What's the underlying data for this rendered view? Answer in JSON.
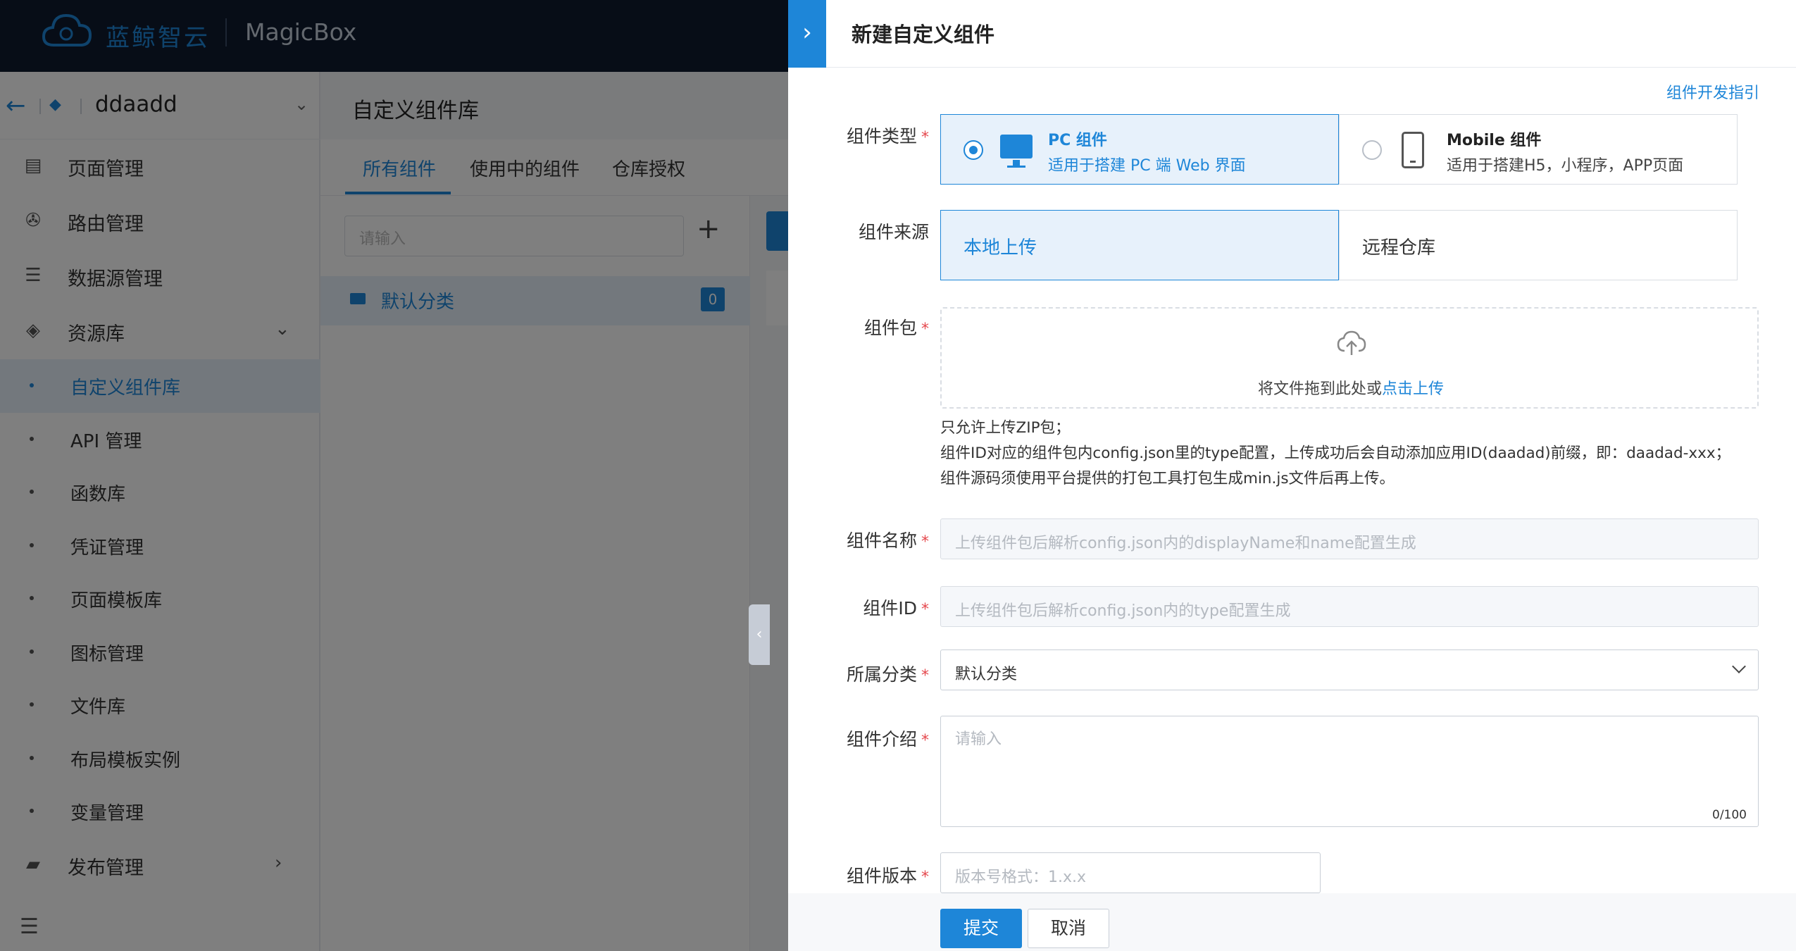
{
  "app": {
    "brand_cn": "蓝鲸智云",
    "brand_en": "MagicBox",
    "accent_color": "#1e86d8"
  },
  "project": {
    "name": "ddaadd"
  },
  "sidebar": {
    "items": [
      {
        "label": "页面管理",
        "icon": "file-icon"
      },
      {
        "label": "路由管理",
        "icon": "route-icon"
      },
      {
        "label": "数据源管理",
        "icon": "database-icon"
      },
      {
        "label": "资源库",
        "icon": "layers-icon"
      }
    ],
    "sub_items": [
      {
        "label": "自定义组件库"
      },
      {
        "label": "API 管理"
      },
      {
        "label": "函数库"
      },
      {
        "label": "凭证管理"
      },
      {
        "label": "页面模板库"
      },
      {
        "label": "图标管理"
      },
      {
        "label": "文件库"
      },
      {
        "label": "布局模板实例"
      },
      {
        "label": "变量管理"
      }
    ],
    "publish": {
      "label": "发布管理",
      "icon": "briefcase-icon"
    }
  },
  "main": {
    "title": "自定义组件库",
    "tabs": [
      {
        "label": "所有组件"
      },
      {
        "label": "使用中的组件"
      },
      {
        "label": "仓库授权"
      }
    ],
    "search_placeholder": "请输入",
    "category": {
      "label": "默认分类",
      "count": "0"
    }
  },
  "drawer": {
    "title": "新建自定义组件",
    "guide_link": "组件开发指引",
    "type": {
      "label": "组件类型",
      "options": [
        {
          "title": "PC 组件",
          "desc": "适用于搭建 PC 端 Web 界面",
          "selected": true
        },
        {
          "title": "Mobile 组件",
          "desc": "适用于搭建H5，小程序，APP页面",
          "selected": false
        }
      ]
    },
    "source": {
      "label": "组件来源",
      "options": [
        {
          "label": "本地上传",
          "selected": true
        },
        {
          "label": "远程仓库",
          "selected": false
        }
      ]
    },
    "package": {
      "label": "组件包",
      "drop_text": "将文件拖到此处或",
      "drop_link": "点击上传",
      "hints": [
        "只允许上传ZIP包；",
        "组件ID对应的组件包内config.json里的type配置，上传成功后会自动添加应用ID(daadad)前缀，即：daadad-xxx；",
        "组件源码须使用平台提供的打包工具打包生成min.js文件后再上传。"
      ]
    },
    "name": {
      "label": "组件名称",
      "placeholder": "上传组件包后解析config.json内的displayName和name配置生成"
    },
    "id": {
      "label": "组件ID",
      "placeholder": "上传组件包后解析config.json内的type配置生成"
    },
    "category": {
      "label": "所属分类",
      "value": "默认分类"
    },
    "intro": {
      "label": "组件介绍",
      "placeholder": "请输入",
      "count": "0/100"
    },
    "version": {
      "label": "组件版本",
      "placeholder": "版本号格式：1.x.x"
    },
    "submit": "提交",
    "cancel": "取消"
  }
}
